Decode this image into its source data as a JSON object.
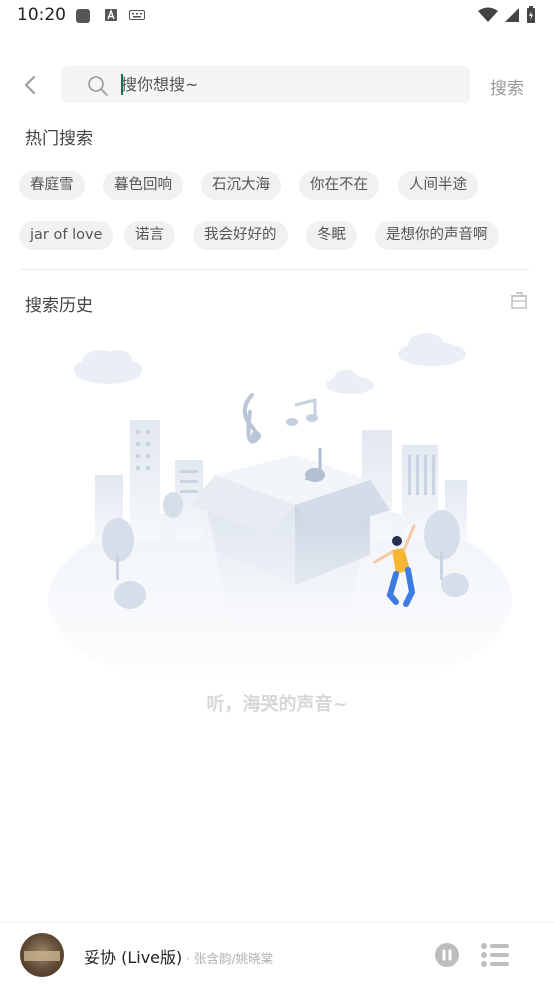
{
  "status_bar": {
    "time": "10:20"
  },
  "search": {
    "placeholder": "搜你想搜~",
    "submit_label": "搜索"
  },
  "hot_search": {
    "title": "热门搜索",
    "tags": [
      "春庭雪",
      "暮色回响",
      "石沉大海",
      "你在不在",
      "人间半途",
      "jar of love",
      "诺言",
      "我会好好的",
      "冬眠",
      "是想你的声音啊"
    ]
  },
  "history": {
    "title": "搜索历史",
    "empty_text": "听，海哭的声音~"
  },
  "player": {
    "title": "妥协 (Live版)",
    "artist": "· 张含韵/姚晓棠"
  }
}
